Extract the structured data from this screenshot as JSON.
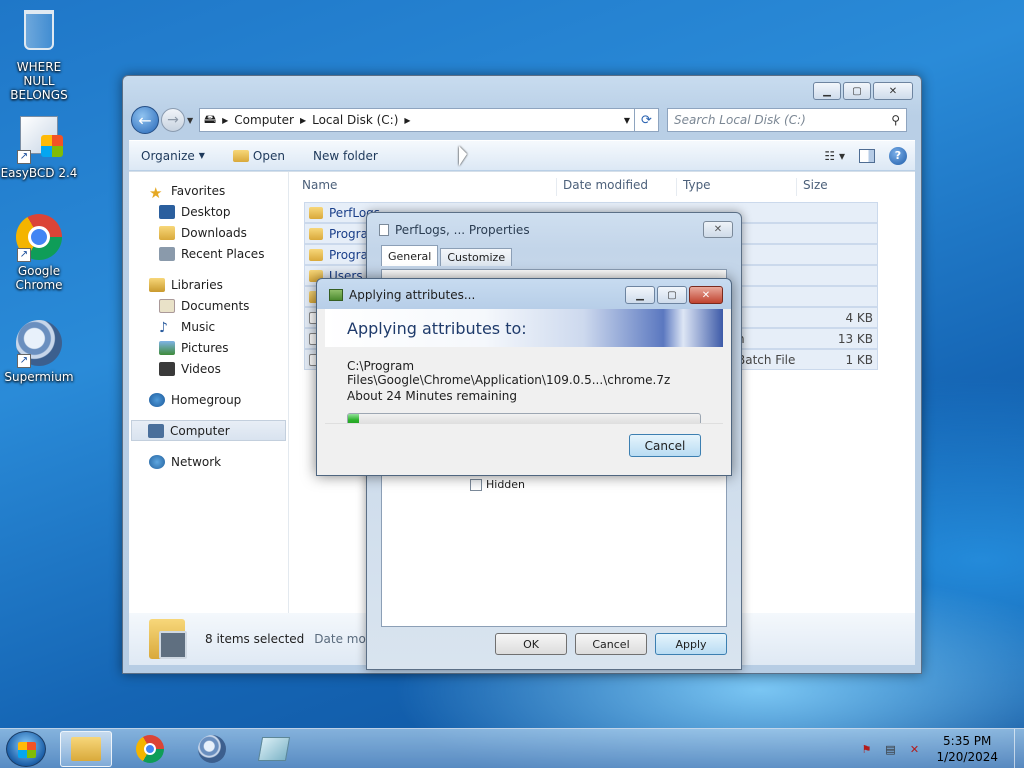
{
  "desktop": {
    "icons": [
      {
        "label": "WHERE NULL BELONGS",
        "icon": "recycle-bin-icon"
      },
      {
        "label": "EasyBCD 2.4",
        "icon": "easybcd-icon"
      },
      {
        "label": "Google Chrome",
        "icon": "chrome-icon"
      },
      {
        "label": "Supermium",
        "icon": "supermium-icon"
      }
    ]
  },
  "explorer": {
    "address": {
      "crumbs": [
        "Computer",
        "Local Disk (C:)"
      ]
    },
    "search_placeholder": "Search Local Disk (C:)",
    "toolbar": {
      "organize": "Organize",
      "open": "Open",
      "new_folder": "New folder"
    },
    "nav": {
      "favorites": "Favorites",
      "favorites_items": [
        "Desktop",
        "Downloads",
        "Recent Places"
      ],
      "libraries": "Libraries",
      "libraries_items": [
        "Documents",
        "Music",
        "Pictures",
        "Videos"
      ],
      "homegroup": "Homegroup",
      "computer": "Computer",
      "network": "Network"
    },
    "columns": {
      "name": "Name",
      "date": "Date modified",
      "type": "Type",
      "size": "Size"
    },
    "rows": [
      {
        "name": "PerfLogs",
        "extra": "",
        "size": ""
      },
      {
        "name": "Progran",
        "extra": "",
        "size": ""
      },
      {
        "name": "Progran",
        "extra": "",
        "size": ""
      },
      {
        "name": "Users",
        "extra": "",
        "size": ""
      },
      {
        "name": "",
        "extra": "",
        "size": ""
      },
      {
        "name": "",
        "extra": "",
        "size": "4 KB"
      },
      {
        "name": "",
        "extra": "n",
        "size": "13 KB"
      },
      {
        "name": "",
        "extra": "Batch File",
        "size": "1 KB"
      }
    ],
    "details": {
      "selected": "8 items selected",
      "date_label": "Date modi"
    }
  },
  "properties": {
    "title": "PerfLogs, ... Properties",
    "tabs": [
      "General",
      "Customize"
    ],
    "hidden_label": "Hidden",
    "buttons": {
      "ok": "OK",
      "cancel": "Cancel",
      "apply": "Apply"
    }
  },
  "apply_dialog": {
    "title": "Applying attributes...",
    "heading": "Applying attributes to:",
    "path": "C:\\Program Files\\Google\\Chrome\\Application\\109.0.5...\\chrome.7z",
    "remaining": "About 24 Minutes remaining",
    "progress": 0.03,
    "cancel": "Cancel"
  },
  "taskbar": {
    "clock_time": "5:35 PM",
    "clock_date": "1/20/2024"
  }
}
